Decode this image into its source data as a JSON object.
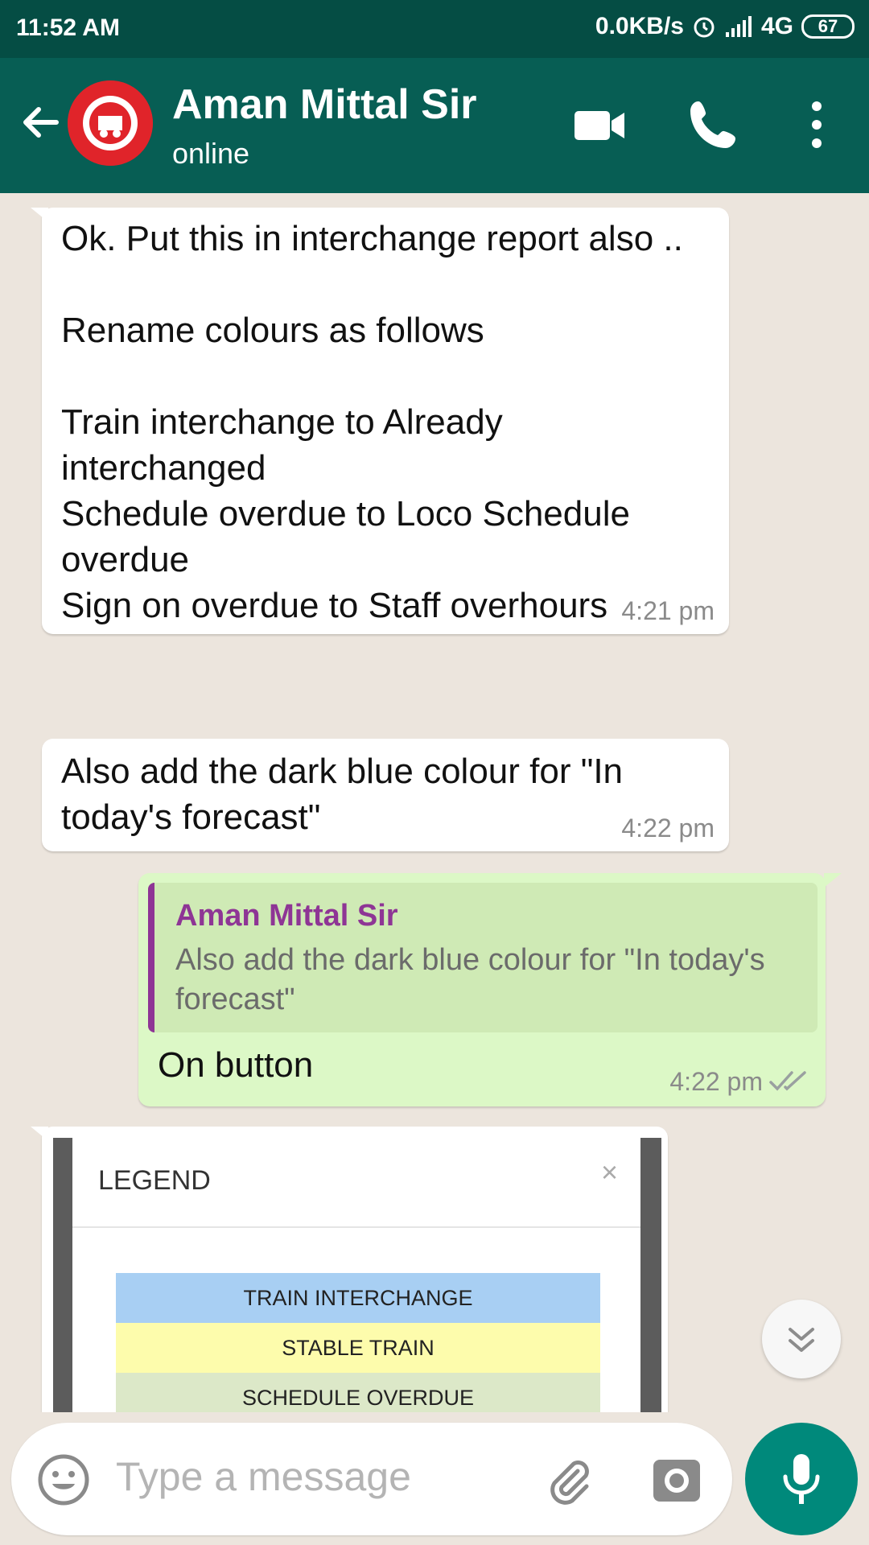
{
  "status_bar": {
    "time": "11:52 AM",
    "network_speed": "0.0KB/s",
    "network_type": "4G",
    "battery": "67"
  },
  "header": {
    "contact_name": "Aman Mittal Sir",
    "contact_status": "online",
    "avatar_icon": "indian-railways-logo",
    "colors": {
      "bar": "#075e54",
      "status_bar": "#054d44"
    }
  },
  "messages": [
    {
      "direction": "incoming",
      "text": "Ok. Put this in interchange report also ..\n\nRename colours as follows\n\nTrain interchange to Already interchanged\nSchedule overdue to Loco Schedule overdue\nSign on overdue to Staff overhours",
      "time": "4:21 pm"
    },
    {
      "direction": "incoming",
      "text": "Also add the dark blue colour for \"In today's forecast\"",
      "time": "4:22 pm"
    },
    {
      "direction": "outgoing",
      "quote_author": "Aman Mittal Sir",
      "quote_text": "Also add the dark blue colour for \"In today's forecast\"",
      "text": "On button",
      "time": "4:22 pm",
      "read_receipt": "double-check-icon"
    },
    {
      "direction": "incoming",
      "type": "image",
      "image": {
        "title": "LEGEND",
        "close": "×",
        "rows": [
          {
            "label": "TRAIN INTERCHANGE",
            "color": "#a8cff3"
          },
          {
            "label": "STABLE TRAIN",
            "color": "#fdfcac"
          },
          {
            "label": "SCHEDULE OVERDUE",
            "color": "#dce8c8"
          }
        ]
      }
    }
  ],
  "input": {
    "placeholder": "Type a message"
  },
  "colors": {
    "incoming_bubble": "#ffffff",
    "outgoing_bubble": "#dcf8c6",
    "chat_background": "#ece5dd",
    "quote_accent": "#8e3595",
    "mic_button": "#00897b"
  }
}
